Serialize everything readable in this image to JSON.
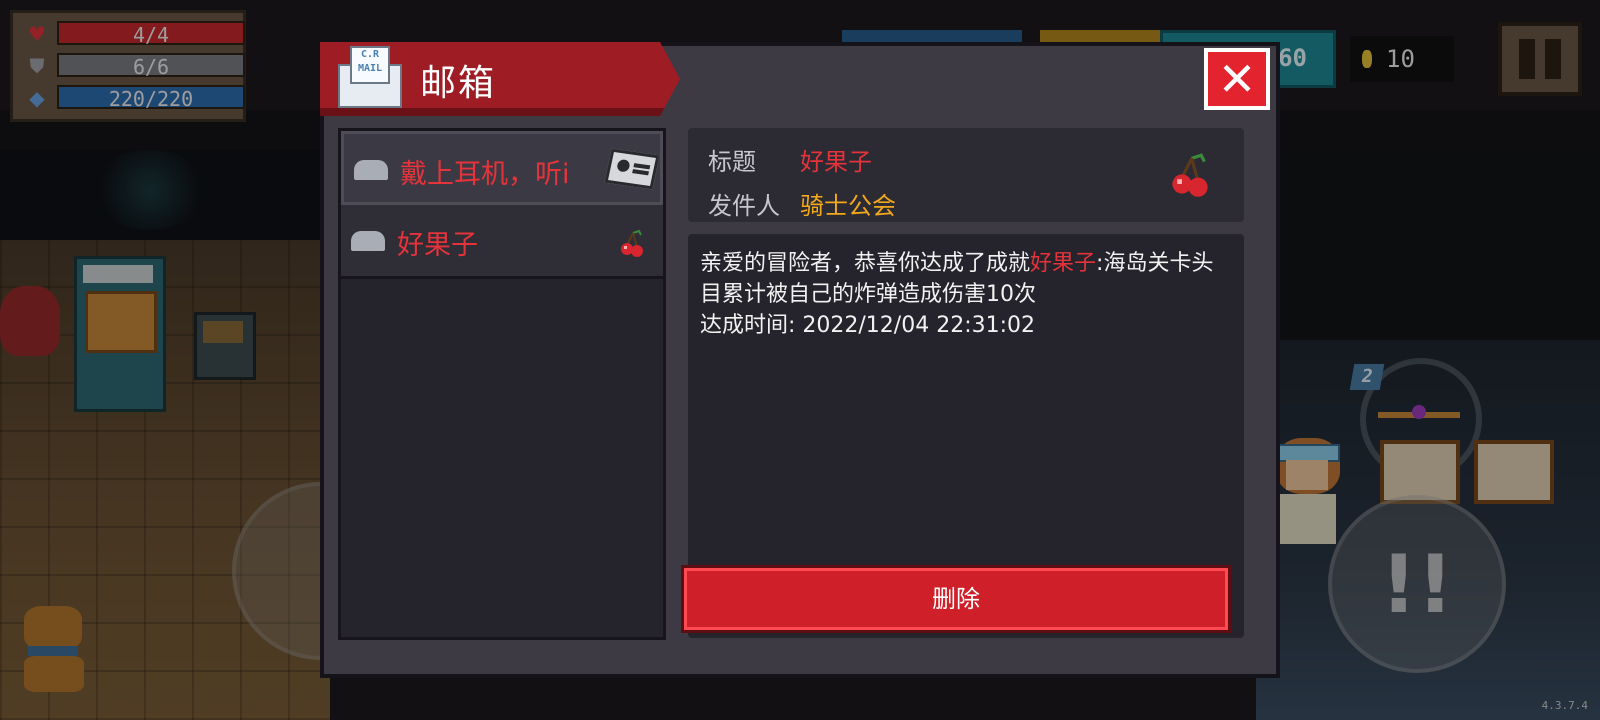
{
  "hud": {
    "hp": "4/4",
    "hp_fill": 1.0,
    "armor": "6/6",
    "armor_fill": 1.0,
    "energy": "220/220",
    "energy_fill": 1.0,
    "gems": "060",
    "coins": "10"
  },
  "mailbox": {
    "title": "邮箱",
    "mail_icon_text": "C.R MAIL",
    "close_symbol": "✕",
    "items": [
      {
        "title": "戴上耳机，听i",
        "icon": "radio-icon",
        "selected": true
      },
      {
        "title": "好果子",
        "icon": "cherry-icon",
        "selected": false
      }
    ],
    "detail": {
      "subject_label": "标题",
      "subject": "好果子",
      "sender_label": "发件人",
      "sender": "骑士公会",
      "body_before": "亲爱的冒险者，恭喜你达成了成就",
      "body_highlight": "好果子",
      "body_after": ":海岛关卡头目累计被自己的炸弹造成伤害10次",
      "body_time": "达成时间: 2022/12/04 22:31:02"
    },
    "delete_label": "删除"
  },
  "controls": {
    "action_symbol": "!!",
    "weapon_swap_badge": "2"
  },
  "version": "4.3.7.4",
  "colors": {
    "accent_red": "#e5333b",
    "sender_orange": "#f2a91c",
    "dialog_bg": "#3d3a44"
  }
}
